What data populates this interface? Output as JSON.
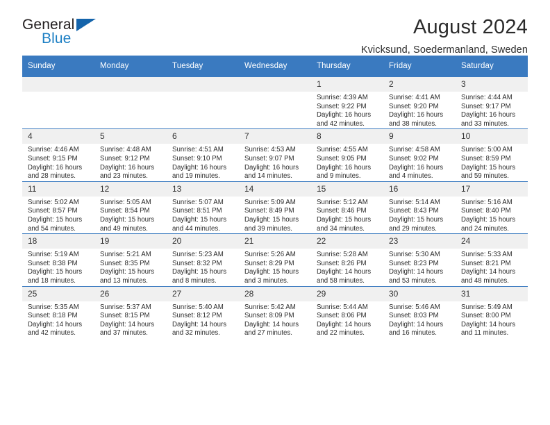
{
  "brand": {
    "name_part1": "General",
    "name_part2": "Blue"
  },
  "header": {
    "title": "August 2024",
    "location": "Kvicksund, Soedermanland, Sweden"
  },
  "weekday_headers": [
    "Sunday",
    "Monday",
    "Tuesday",
    "Wednesday",
    "Thursday",
    "Friday",
    "Saturday"
  ],
  "colors": {
    "header_blue": "#3a7ac0",
    "brand_blue": "#1c7fc4",
    "daynum_bg": "#f0f0f0"
  },
  "labels": {
    "sunrise_prefix": "Sunrise:",
    "sunset_prefix": "Sunset:",
    "daylight_prefix": "Daylight:"
  },
  "weeks": [
    [
      {
        "empty": true
      },
      {
        "empty": true
      },
      {
        "empty": true
      },
      {
        "empty": true
      },
      {
        "day": "1",
        "sunrise": "Sunrise: 4:39 AM",
        "sunset": "Sunset: 9:22 PM",
        "daylight": "Daylight: 16 hours and 42 minutes."
      },
      {
        "day": "2",
        "sunrise": "Sunrise: 4:41 AM",
        "sunset": "Sunset: 9:20 PM",
        "daylight": "Daylight: 16 hours and 38 minutes."
      },
      {
        "day": "3",
        "sunrise": "Sunrise: 4:44 AM",
        "sunset": "Sunset: 9:17 PM",
        "daylight": "Daylight: 16 hours and 33 minutes."
      }
    ],
    [
      {
        "day": "4",
        "sunrise": "Sunrise: 4:46 AM",
        "sunset": "Sunset: 9:15 PM",
        "daylight": "Daylight: 16 hours and 28 minutes."
      },
      {
        "day": "5",
        "sunrise": "Sunrise: 4:48 AM",
        "sunset": "Sunset: 9:12 PM",
        "daylight": "Daylight: 16 hours and 23 minutes."
      },
      {
        "day": "6",
        "sunrise": "Sunrise: 4:51 AM",
        "sunset": "Sunset: 9:10 PM",
        "daylight": "Daylight: 16 hours and 19 minutes."
      },
      {
        "day": "7",
        "sunrise": "Sunrise: 4:53 AM",
        "sunset": "Sunset: 9:07 PM",
        "daylight": "Daylight: 16 hours and 14 minutes."
      },
      {
        "day": "8",
        "sunrise": "Sunrise: 4:55 AM",
        "sunset": "Sunset: 9:05 PM",
        "daylight": "Daylight: 16 hours and 9 minutes."
      },
      {
        "day": "9",
        "sunrise": "Sunrise: 4:58 AM",
        "sunset": "Sunset: 9:02 PM",
        "daylight": "Daylight: 16 hours and 4 minutes."
      },
      {
        "day": "10",
        "sunrise": "Sunrise: 5:00 AM",
        "sunset": "Sunset: 8:59 PM",
        "daylight": "Daylight: 15 hours and 59 minutes."
      }
    ],
    [
      {
        "day": "11",
        "sunrise": "Sunrise: 5:02 AM",
        "sunset": "Sunset: 8:57 PM",
        "daylight": "Daylight: 15 hours and 54 minutes."
      },
      {
        "day": "12",
        "sunrise": "Sunrise: 5:05 AM",
        "sunset": "Sunset: 8:54 PM",
        "daylight": "Daylight: 15 hours and 49 minutes."
      },
      {
        "day": "13",
        "sunrise": "Sunrise: 5:07 AM",
        "sunset": "Sunset: 8:51 PM",
        "daylight": "Daylight: 15 hours and 44 minutes."
      },
      {
        "day": "14",
        "sunrise": "Sunrise: 5:09 AM",
        "sunset": "Sunset: 8:49 PM",
        "daylight": "Daylight: 15 hours and 39 minutes."
      },
      {
        "day": "15",
        "sunrise": "Sunrise: 5:12 AM",
        "sunset": "Sunset: 8:46 PM",
        "daylight": "Daylight: 15 hours and 34 minutes."
      },
      {
        "day": "16",
        "sunrise": "Sunrise: 5:14 AM",
        "sunset": "Sunset: 8:43 PM",
        "daylight": "Daylight: 15 hours and 29 minutes."
      },
      {
        "day": "17",
        "sunrise": "Sunrise: 5:16 AM",
        "sunset": "Sunset: 8:40 PM",
        "daylight": "Daylight: 15 hours and 24 minutes."
      }
    ],
    [
      {
        "day": "18",
        "sunrise": "Sunrise: 5:19 AM",
        "sunset": "Sunset: 8:38 PM",
        "daylight": "Daylight: 15 hours and 18 minutes."
      },
      {
        "day": "19",
        "sunrise": "Sunrise: 5:21 AM",
        "sunset": "Sunset: 8:35 PM",
        "daylight": "Daylight: 15 hours and 13 minutes."
      },
      {
        "day": "20",
        "sunrise": "Sunrise: 5:23 AM",
        "sunset": "Sunset: 8:32 PM",
        "daylight": "Daylight: 15 hours and 8 minutes."
      },
      {
        "day": "21",
        "sunrise": "Sunrise: 5:26 AM",
        "sunset": "Sunset: 8:29 PM",
        "daylight": "Daylight: 15 hours and 3 minutes."
      },
      {
        "day": "22",
        "sunrise": "Sunrise: 5:28 AM",
        "sunset": "Sunset: 8:26 PM",
        "daylight": "Daylight: 14 hours and 58 minutes."
      },
      {
        "day": "23",
        "sunrise": "Sunrise: 5:30 AM",
        "sunset": "Sunset: 8:23 PM",
        "daylight": "Daylight: 14 hours and 53 minutes."
      },
      {
        "day": "24",
        "sunrise": "Sunrise: 5:33 AM",
        "sunset": "Sunset: 8:21 PM",
        "daylight": "Daylight: 14 hours and 48 minutes."
      }
    ],
    [
      {
        "day": "25",
        "sunrise": "Sunrise: 5:35 AM",
        "sunset": "Sunset: 8:18 PM",
        "daylight": "Daylight: 14 hours and 42 minutes."
      },
      {
        "day": "26",
        "sunrise": "Sunrise: 5:37 AM",
        "sunset": "Sunset: 8:15 PM",
        "daylight": "Daylight: 14 hours and 37 minutes."
      },
      {
        "day": "27",
        "sunrise": "Sunrise: 5:40 AM",
        "sunset": "Sunset: 8:12 PM",
        "daylight": "Daylight: 14 hours and 32 minutes."
      },
      {
        "day": "28",
        "sunrise": "Sunrise: 5:42 AM",
        "sunset": "Sunset: 8:09 PM",
        "daylight": "Daylight: 14 hours and 27 minutes."
      },
      {
        "day": "29",
        "sunrise": "Sunrise: 5:44 AM",
        "sunset": "Sunset: 8:06 PM",
        "daylight": "Daylight: 14 hours and 22 minutes."
      },
      {
        "day": "30",
        "sunrise": "Sunrise: 5:46 AM",
        "sunset": "Sunset: 8:03 PM",
        "daylight": "Daylight: 14 hours and 16 minutes."
      },
      {
        "day": "31",
        "sunrise": "Sunrise: 5:49 AM",
        "sunset": "Sunset: 8:00 PM",
        "daylight": "Daylight: 14 hours and 11 minutes."
      }
    ]
  ]
}
